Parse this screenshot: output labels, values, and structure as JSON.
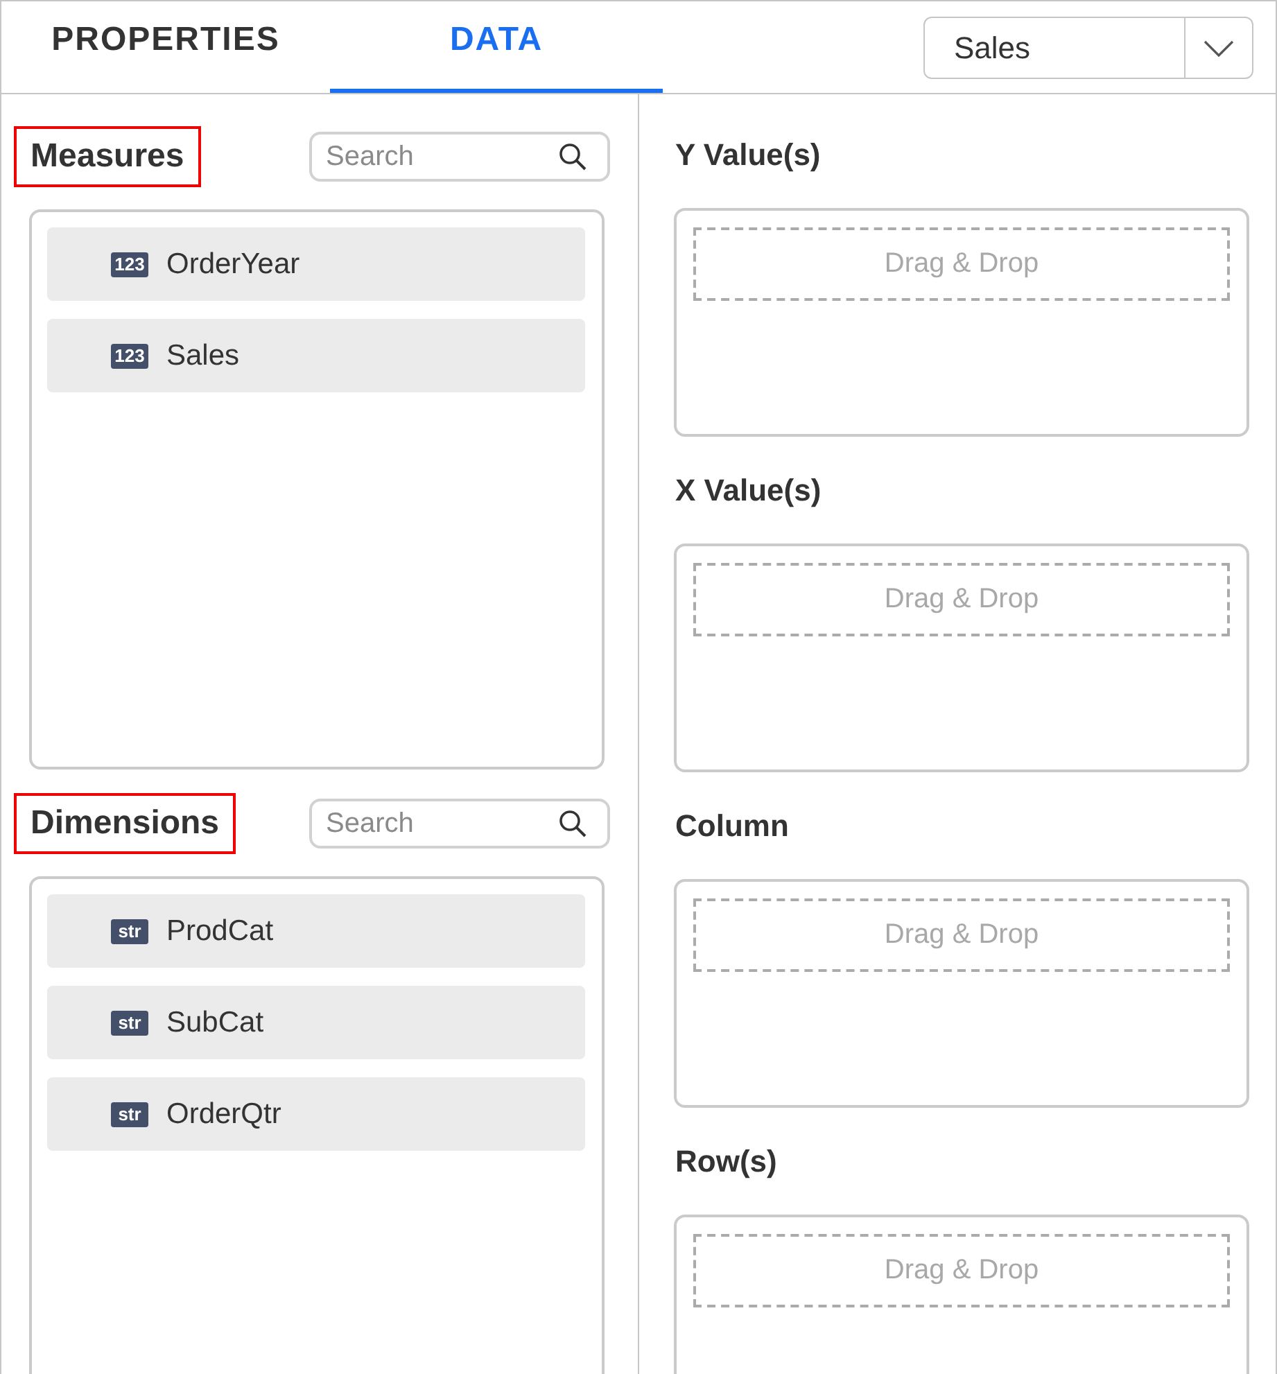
{
  "tabs": [
    {
      "label": "PROPERTIES",
      "selected": false
    },
    {
      "label": "DATA",
      "selected": true
    }
  ],
  "dataset_dropdown": {
    "value": "Sales"
  },
  "field_sections": [
    {
      "title": "Measures",
      "highlighted": true,
      "search": {
        "placeholder": "Search"
      },
      "fields": [
        {
          "badge": "123",
          "name": "OrderYear"
        },
        {
          "badge": "123",
          "name": "Sales"
        }
      ]
    },
    {
      "title": "Dimensions",
      "highlighted": true,
      "search": {
        "placeholder": "Search"
      },
      "fields": [
        {
          "badge": "str",
          "name": "ProdCat"
        },
        {
          "badge": "str",
          "name": "SubCat"
        },
        {
          "badge": "str",
          "name": "OrderQtr"
        }
      ]
    }
  ],
  "drop_zones": [
    {
      "title": "Y Value(s)",
      "prompt": "Drag & Drop"
    },
    {
      "title": "X Value(s)",
      "prompt": "Drag & Drop"
    },
    {
      "title": "Column",
      "prompt": "Drag & Drop"
    },
    {
      "title": "Row(s)",
      "prompt": "Drag & Drop"
    }
  ]
}
